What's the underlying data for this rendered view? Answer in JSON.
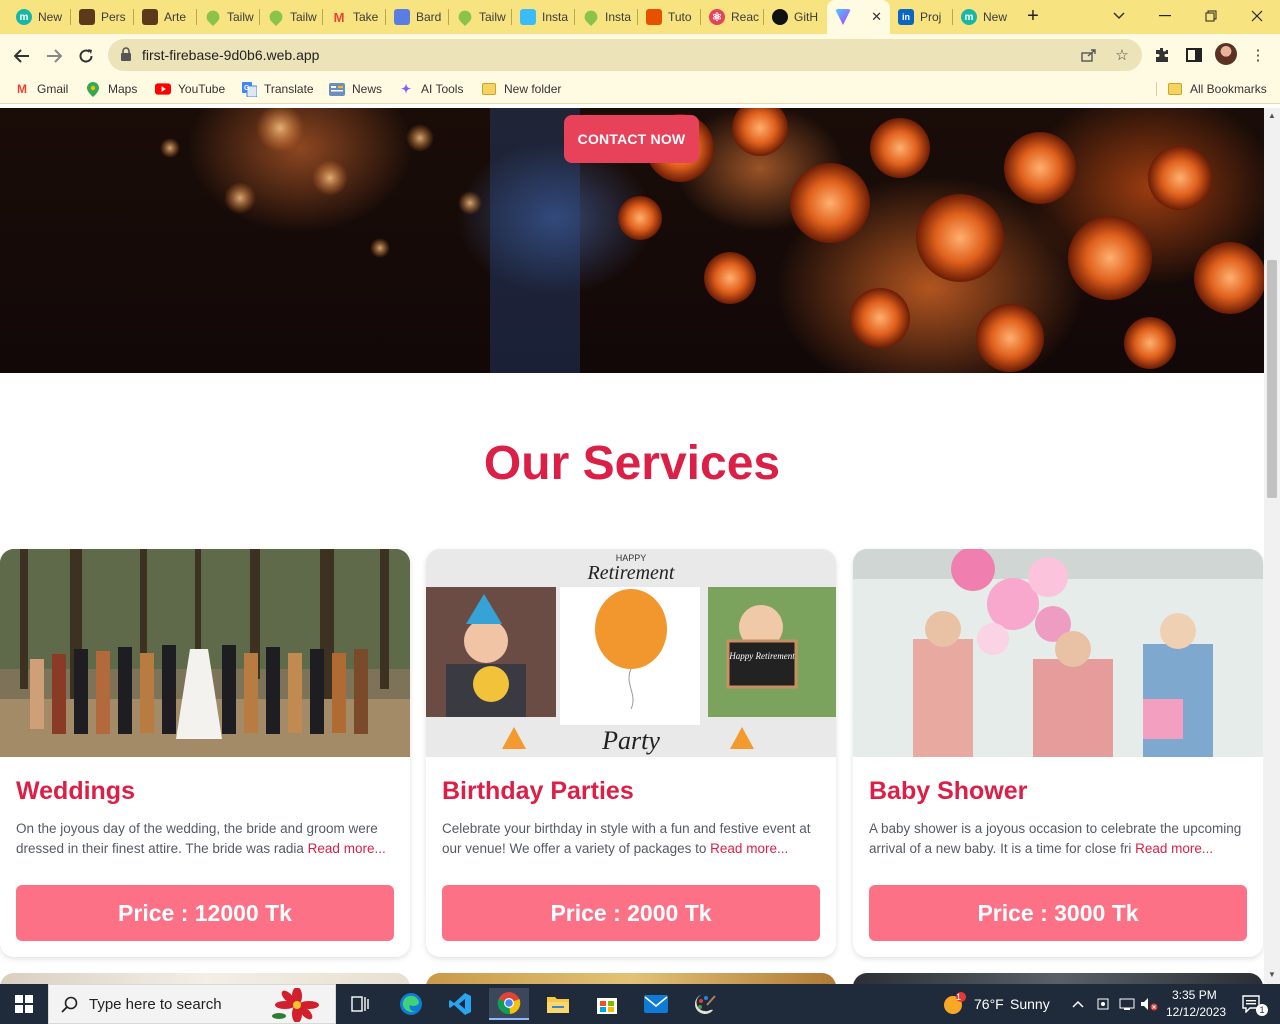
{
  "browser": {
    "tabs": [
      {
        "label": "New",
        "icon": "m-circle-icon",
        "color": "#17b6a5"
      },
      {
        "label": "Pers",
        "icon": "book-icon",
        "color": "#5a3a1a"
      },
      {
        "label": "Arte",
        "icon": "book-icon",
        "color": "#5a3a1a"
      },
      {
        "label": "Tailw",
        "icon": "pin-icon",
        "color": "#8bc34a"
      },
      {
        "label": "Tailw",
        "icon": "pin-icon",
        "color": "#8bc34a"
      },
      {
        "label": "Take",
        "icon": "gmail-icon",
        "color": "#ea4335"
      },
      {
        "label": "Bard",
        "icon": "sparkle-icon",
        "color": "#5b7ce0"
      },
      {
        "label": "Tailw",
        "icon": "pin-icon",
        "color": "#8bc34a"
      },
      {
        "label": "Insta",
        "icon": "wave-icon",
        "color": "#38bdf8"
      },
      {
        "label": "Insta",
        "icon": "pin-icon",
        "color": "#8bc34a"
      },
      {
        "label": "Tuto",
        "icon": "chart-icon",
        "color": "#e65100"
      },
      {
        "label": "Reac",
        "icon": "react-icon",
        "color": "#e8415a"
      },
      {
        "label": "GitH",
        "icon": "github-icon",
        "color": "#111111"
      },
      {
        "label": "",
        "icon": "vite-icon",
        "color": "#a855f7",
        "active": true
      },
      {
        "label": "Proj",
        "icon": "linkedin-icon",
        "color": "#0a66c2"
      },
      {
        "label": "New",
        "icon": "m-circle-icon",
        "color": "#17b6a5"
      }
    ],
    "new_tab": "+",
    "url": "first-firebase-9d0b6.web.app",
    "bookmarks": [
      {
        "label": "Gmail",
        "icon": "gmail-icon"
      },
      {
        "label": "Maps",
        "icon": "maps-pin-icon"
      },
      {
        "label": "YouTube",
        "icon": "youtube-icon"
      },
      {
        "label": "Translate",
        "icon": "translate-icon"
      },
      {
        "label": "News",
        "icon": "news-icon"
      },
      {
        "label": "AI Tools",
        "icon": "sparkle-icon"
      },
      {
        "label": "New folder",
        "icon": "folder-icon"
      }
    ],
    "all_bookmarks": "All Bookmarks"
  },
  "page": {
    "hero": {
      "contact_button": "CONTACT NOW"
    },
    "services_title": "Our Services",
    "services": [
      {
        "title": "Weddings",
        "description": "On the joyous day of the wedding, the bride and groom were dressed in their finest attire. The bride was radia",
        "read_more": "Read more...",
        "price": "Price : 12000 Tk"
      },
      {
        "title": "Birthday Parties",
        "description": "Celebrate your birthday in style with a fun and festive event at our venue! We offer a variety of packages to",
        "read_more": "Read more...",
        "price": "Price : 2000 Tk",
        "image_text_top": "HAPPY",
        "image_text_main": "Retirement",
        "image_text_sign": "Happy Retirement",
        "image_text_bottom": "Party"
      },
      {
        "title": "Baby Shower",
        "description": "A baby shower is a joyous occasion to celebrate the upcoming arrival of a new baby. It is a time for close fri",
        "read_more": "Read more...",
        "price": "Price : 3000 Tk"
      }
    ]
  },
  "taskbar": {
    "search_placeholder": "Type here to search",
    "weather_temp": "76°F",
    "weather_text": "Sunny",
    "weather_badge": "1",
    "time": "3:35 PM",
    "date": "12/12/2023",
    "notification_count": "1"
  },
  "colors": {
    "accent": "#dc1f46",
    "price_button": "#fd7187",
    "contact_button": "#e8415a",
    "browser_frame": "#f7e37f"
  }
}
